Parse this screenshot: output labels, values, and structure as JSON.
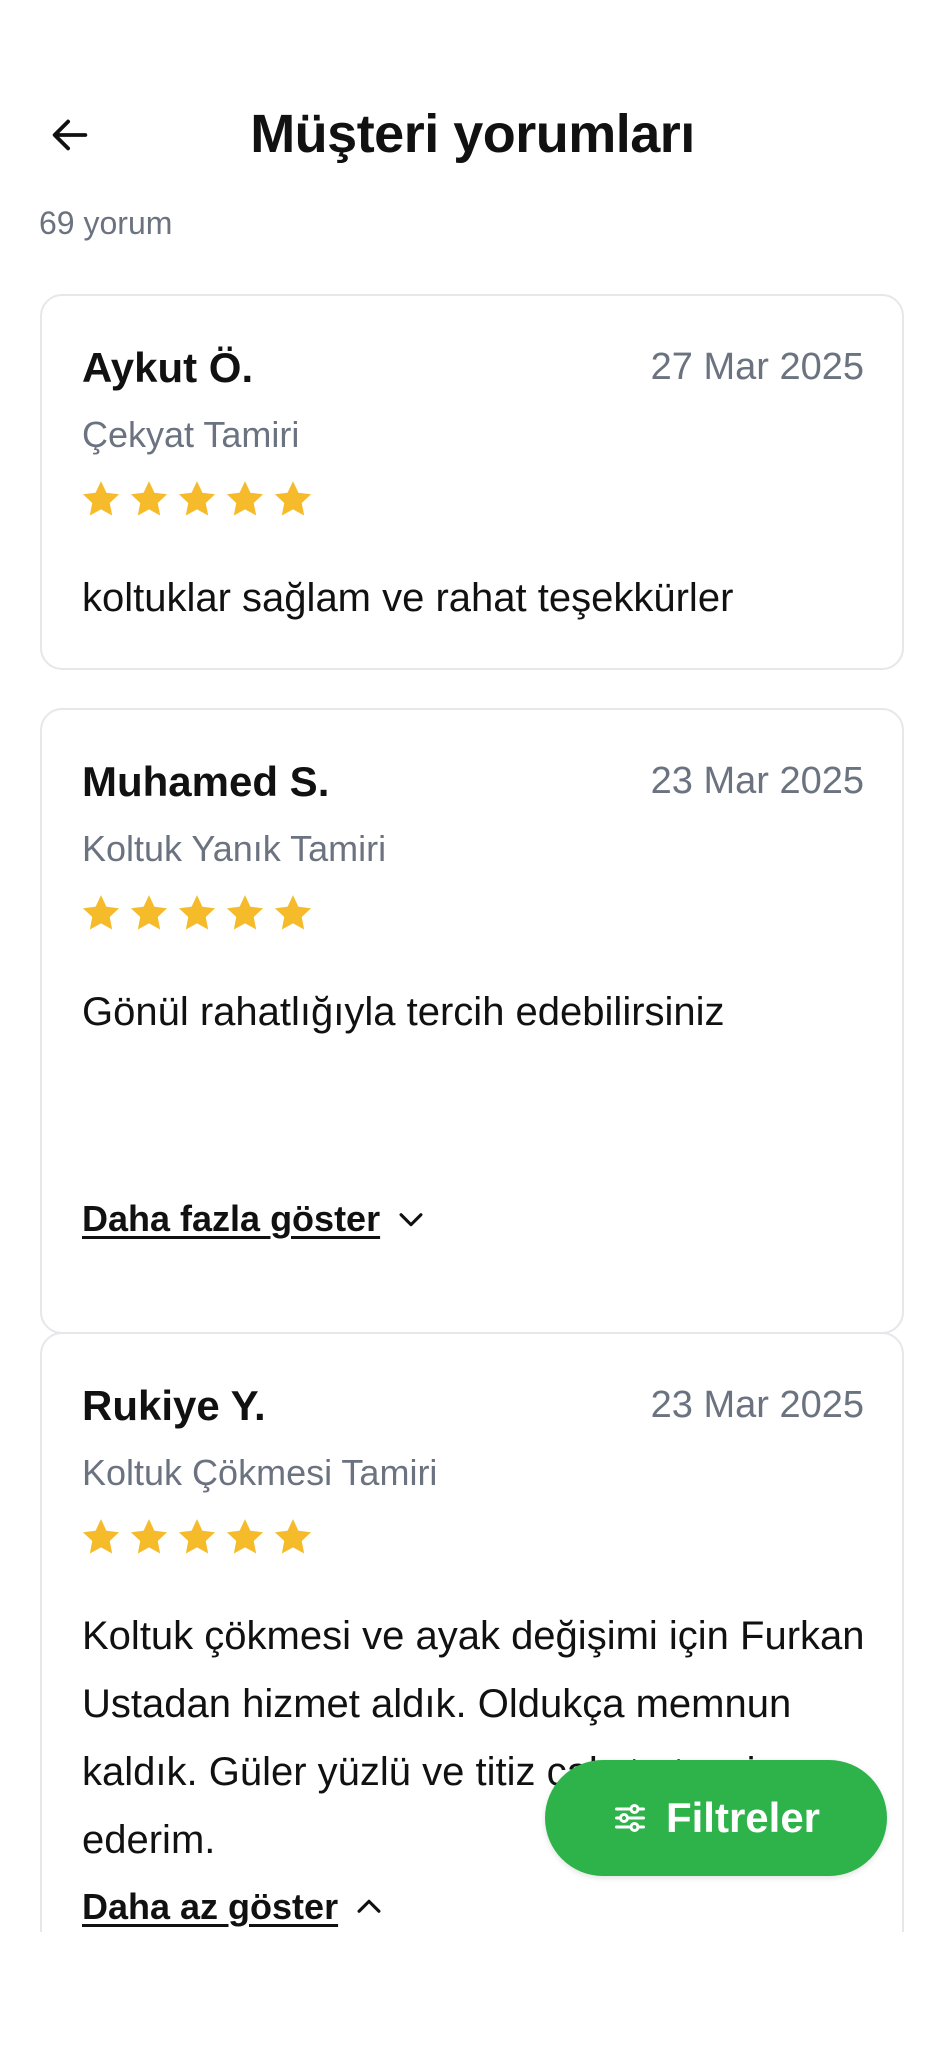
{
  "header": {
    "title": "Müşteri yorumları",
    "back_icon": "arrow-left-icon"
  },
  "summary": {
    "review_count": "69 yorum"
  },
  "reviews": [
    {
      "name": "Aykut Ö.",
      "date": "27 Mar 2025",
      "service": "Çekyat Tamiri",
      "rating": 5,
      "comment": "koltuklar sağlam ve rahat teşekkürler"
    },
    {
      "name": "Muhamed S.",
      "date": "23 Mar 2025",
      "service": "Koltuk Yanık Tamiri",
      "rating": 5,
      "comment": "Gönül rahatlığıyla tercih edebilirsiniz",
      "toggle_label": "Daha fazla göster"
    },
    {
      "name": "Rukiye Y.",
      "date": "23 Mar 2025",
      "service": "Koltuk Çökmesi Tamiri",
      "rating": 5,
      "comment": "Koltuk çökmesi ve ayak değişimi için Furkan Ustadan hizmet aldık.  Oldukça memnun kaldık. Güler yüzlü ve titiz çalıştı. tavsiye ederim.",
      "toggle_label": "Daha az göster"
    }
  ],
  "filter_button": {
    "label": "Filtreler",
    "icon": "sliders-icon",
    "color": "#2db34a"
  },
  "colors": {
    "star": "#f6bb2a",
    "muted_text": "#6b7280",
    "card_border": "#e5e7eb"
  }
}
